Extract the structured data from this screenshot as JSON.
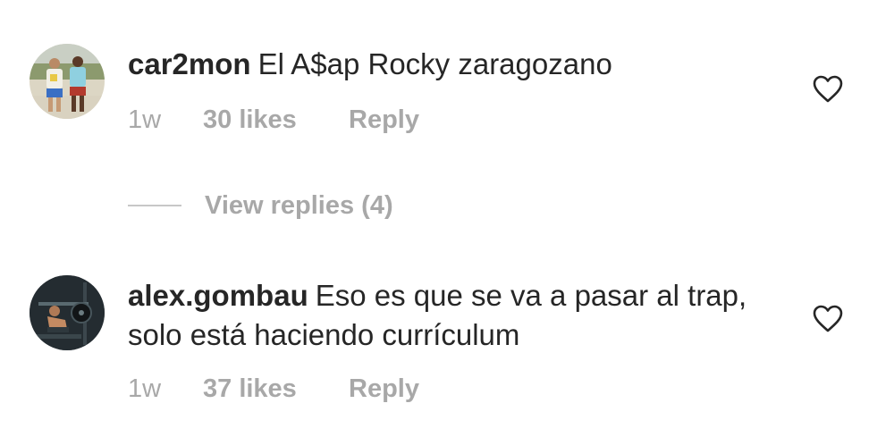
{
  "comments": [
    {
      "username": "car2mon",
      "text": "El A$ap Rocky zaragozano",
      "time": "1w",
      "likes": "30 likes",
      "reply_label": "Reply",
      "avatar_icon": "photo-two-people-avatar",
      "like_icon": "heart-outline-icon"
    },
    {
      "username": "alex.gombau",
      "text": "Eso es que se va a pasar al trap, solo está haciendo currículum",
      "time": "1w",
      "likes": "37 likes",
      "reply_label": "Reply",
      "avatar_icon": "photo-gym-avatar",
      "like_icon": "heart-outline-icon"
    }
  ],
  "view_replies": {
    "label": "View replies (4)"
  },
  "colors": {
    "text": "#262626",
    "secondary": "#a8a8a8",
    "divider": "#c7c7c7",
    "background": "#ffffff"
  }
}
